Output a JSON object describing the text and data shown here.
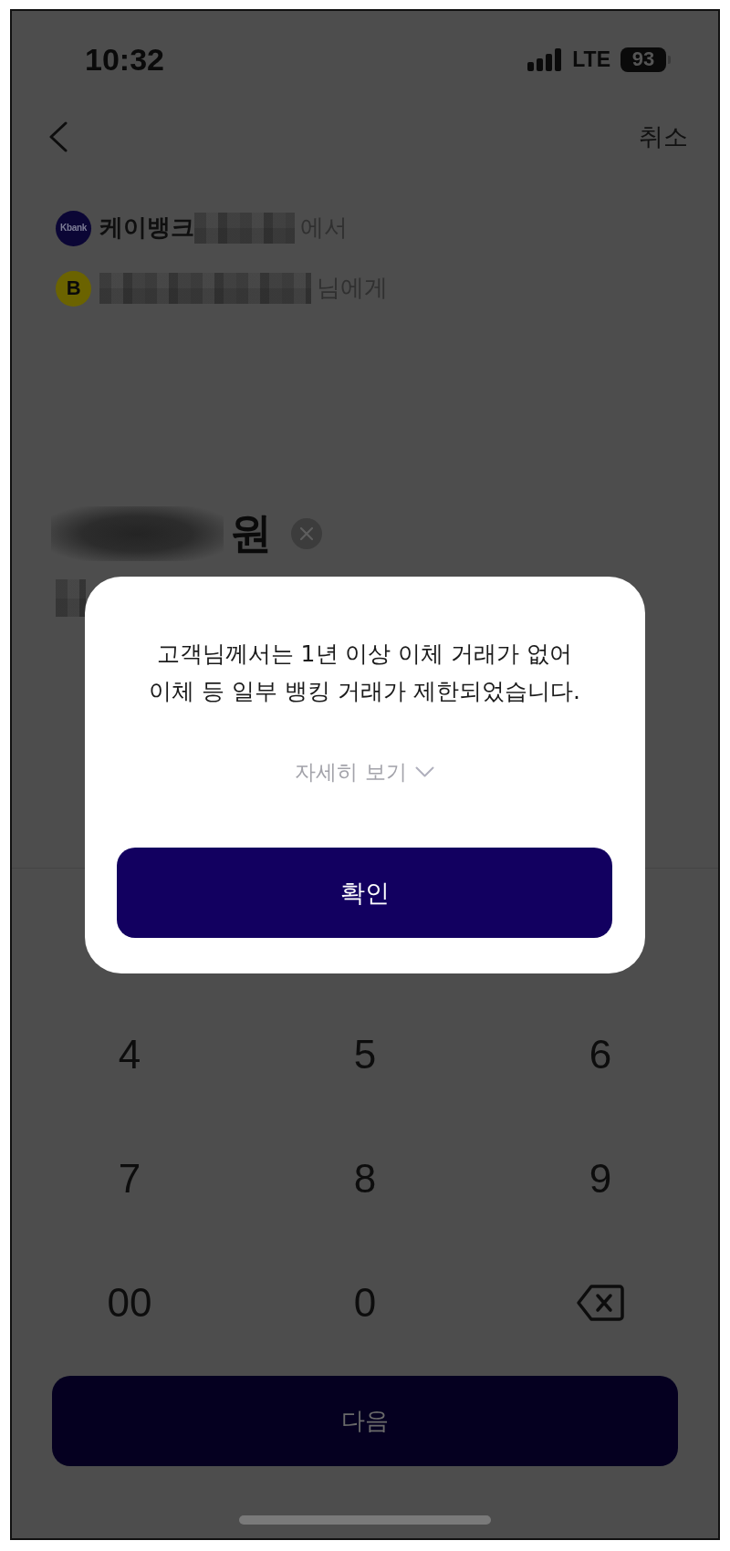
{
  "status_bar": {
    "time": "10:32",
    "network": "LTE",
    "battery": "93"
  },
  "header": {
    "cancel": "취소"
  },
  "accounts": [
    {
      "kind": "from",
      "logo": "Kbank",
      "bank": "케이뱅크",
      "suffix": "에서"
    },
    {
      "kind": "to",
      "logo": "B",
      "suffix": "님에게"
    }
  ],
  "amount": {
    "unit": "원"
  },
  "keypad": [
    {
      "kind": "digit",
      "label": "4"
    },
    {
      "kind": "digit",
      "label": "5"
    },
    {
      "kind": "digit",
      "label": "6"
    },
    {
      "kind": "digit",
      "label": "7"
    },
    {
      "kind": "digit",
      "label": "8"
    },
    {
      "kind": "digit",
      "label": "9"
    },
    {
      "kind": "digit",
      "label": "00"
    },
    {
      "kind": "digit",
      "label": "0"
    },
    {
      "kind": "backspace"
    }
  ],
  "next_button": {
    "label": "다음"
  },
  "dialog": {
    "message": "고객님께서는 1년 이상 이체 거래가 없어\n이체 등 일부 뱅킹 거래가 제한되었습니다.",
    "details_link": "자세히 보기",
    "confirm_button": "확인"
  }
}
